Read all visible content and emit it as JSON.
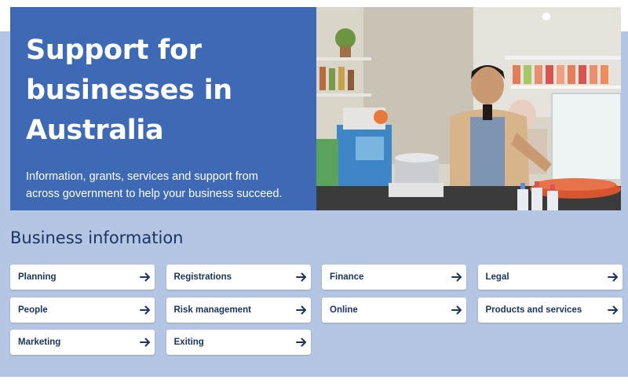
{
  "hero": {
    "title_lines": [
      "Support for",
      "businesses in",
      "Australia"
    ],
    "description_lines": [
      "Information, grants, services and support from",
      "across government to help your business succeed."
    ]
  },
  "section": {
    "title": "Business information",
    "tiles": [
      {
        "label": "Planning"
      },
      {
        "label": "Registrations"
      },
      {
        "label": "Finance"
      },
      {
        "label": "Legal"
      },
      {
        "label": "People"
      },
      {
        "label": "Risk management"
      },
      {
        "label": "Online"
      },
      {
        "label": "Products and services"
      },
      {
        "label": "Marketing"
      },
      {
        "label": "Exiting"
      }
    ],
    "arrow_icon": "arrow-right-icon"
  },
  "colors": {
    "hero_blue": "#3d69b5",
    "band": "#b4c6e3",
    "heading": "#1c3464",
    "arrow": "#1c3464"
  }
}
